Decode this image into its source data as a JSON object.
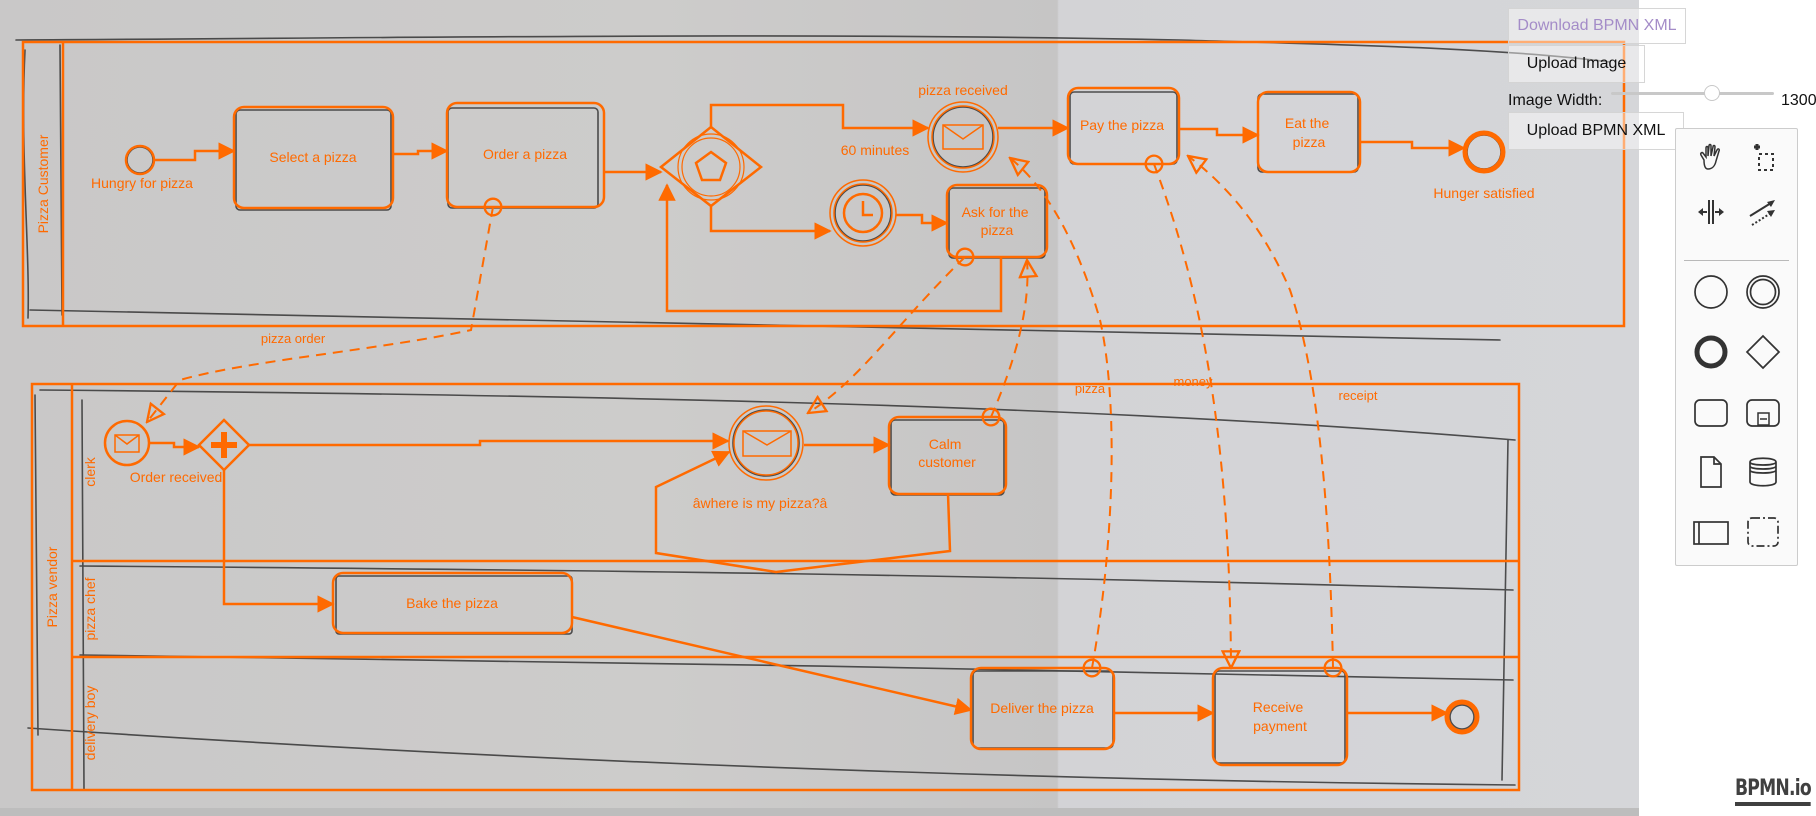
{
  "app": {
    "name": "bpmn-js sketch overlay editor",
    "brand_color": "#ff6a00",
    "logo_text": "BPMN.io"
  },
  "controls": {
    "download_label": "Download BPMN XML",
    "upload_image_label": "Upload Image",
    "image_width_label": "Image Width:",
    "image_width_value": "1300",
    "image_width_slider_fraction": 0.62,
    "upload_bpmn_label": "Upload BPMN XML"
  },
  "palette": {
    "tools": [
      {
        "name": "hand-tool",
        "icon": "hand-icon"
      },
      {
        "name": "lasso-tool",
        "icon": "lasso-icon"
      },
      {
        "name": "space-tool",
        "icon": "space-tool-icon"
      },
      {
        "name": "global-connect-tool",
        "icon": "connect-icon"
      }
    ],
    "elements": [
      {
        "name": "start-event",
        "icon": "start-event-icon"
      },
      {
        "name": "intermediate-event",
        "icon": "intermediate-event-icon"
      },
      {
        "name": "end-event",
        "icon": "end-event-icon"
      },
      {
        "name": "gateway",
        "icon": "gateway-icon"
      },
      {
        "name": "task",
        "icon": "task-icon"
      },
      {
        "name": "subprocess",
        "icon": "subprocess-icon"
      },
      {
        "name": "data-object",
        "icon": "data-object-icon"
      },
      {
        "name": "data-store",
        "icon": "data-store-icon"
      },
      {
        "name": "participant",
        "icon": "participant-icon"
      },
      {
        "name": "group",
        "icon": "group-icon"
      }
    ]
  },
  "diagram": {
    "pools": [
      {
        "id": "customer",
        "label": "Pizza Customer",
        "lanes": []
      },
      {
        "id": "vendor",
        "label": "Pizza vendor",
        "lanes": [
          {
            "label": "clerk"
          },
          {
            "label": "pizza chef"
          },
          {
            "label": "delivery boy"
          }
        ]
      }
    ],
    "events": {
      "hungry": "Hungry for pizza",
      "pizza_received": "pizza received",
      "timer_60": "60 minutes",
      "hunger_satisfied": "Hunger satisfied",
      "order_received": "Order received",
      "where_is_my_pizza": "âwhere is my pizza?â"
    },
    "tasks": {
      "select": "Select a pizza",
      "order": "Order a pizza",
      "ask": "Ask for the pizza",
      "pay": "Pay the pizza",
      "eat": "Eat the pizza",
      "calm": "Calm customer",
      "bake": "Bake the pizza",
      "deliver": "Deliver the pizza",
      "receive_payment": "Receive payment"
    },
    "message_flows": {
      "pizza_order": "pizza order",
      "pizza": "pizza",
      "money": "money",
      "receipt": "receipt"
    }
  }
}
